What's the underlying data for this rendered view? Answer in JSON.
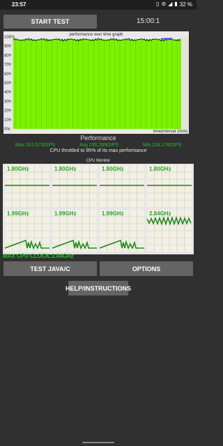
{
  "status_bar": {
    "time": "23:57",
    "battery": "32 %",
    "icons": [
      "vibrate-icon",
      "mute-icon",
      "wifi-icon",
      "battery-icon"
    ]
  },
  "controls": {
    "start_test": "START TEST",
    "timer": "15:00:1",
    "test_java": "TEST JAVA/C",
    "options": "OPTIONS",
    "help": "HELP/INSTRUCTIONS"
  },
  "performance": {
    "graph_title": "performance over time graph",
    "section_title": "Performance",
    "max": "Max 241,570GIPS",
    "avg": "Avg 235,289GIPS",
    "min": "Min 224,176GIPS",
    "throttle_text": "CPU throttled to 95% of its max performance",
    "x_axis_label": "time(interval 2min)",
    "y_ticks": [
      "100%",
      "90%",
      "80%",
      "70%",
      "60%",
      "50%",
      "40%",
      "30%",
      "20%",
      "10%",
      "0%"
    ],
    "colors": {
      "fill": "#7cf200",
      "line": "#1a1a1a",
      "dip": "#2b3cff"
    },
    "fill_fraction_of_time": 0.92,
    "level_percent": 97
  },
  "cpu_monitor": {
    "title": "CPU Monitor",
    "max_clock": "MAX CPU CLOCK:2.84GHz",
    "cores": [
      {
        "label": "1.80GHz"
      },
      {
        "label": "1.80GHz"
      },
      {
        "label": "1.80GHz"
      },
      {
        "label": "1.80GHz"
      },
      {
        "label": "1.99GHz"
      },
      {
        "label": "1.99GHz"
      },
      {
        "label": "1.99GHz"
      },
      {
        "label": "2.84GHz"
      }
    ],
    "line_color": "#1f8a1f"
  }
}
